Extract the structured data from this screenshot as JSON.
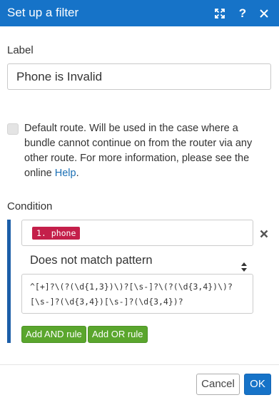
{
  "dialog": {
    "title": "Set up a filter",
    "header_icons": [
      "expand-icon",
      "help-icon",
      "close-icon"
    ],
    "help_glyph": "?"
  },
  "label_section": {
    "label": "Label",
    "value": "Phone is Invalid"
  },
  "default_route": {
    "checked": false,
    "text": "Default route. Will be used in the case where a bundle cannot continue on from the router via any other route. For more information, please see the online",
    "link_text": "Help",
    "trailing": "."
  },
  "condition": {
    "label": "Condition",
    "field_pill": "1. phone",
    "operator": "Does not match pattern",
    "pattern": "^[+]?\\(?(\\d{1,3})\\)?[\\s-]?\\(?(\\d{3,4})\\)?[\\s-]?(\\d{3,4})[\\s-]?(\\d{3,4})?",
    "add_and_label": "Add AND rule",
    "add_or_label": "Add OR rule"
  },
  "footer": {
    "cancel_label": "Cancel",
    "ok_label": "OK"
  },
  "colors": {
    "header_bg": "#1673c8",
    "pill_bg": "#c41f4a",
    "condition_bar": "#1c5ea8",
    "add_rule_bg": "#5aa62d",
    "link": "#1a6fb5"
  }
}
